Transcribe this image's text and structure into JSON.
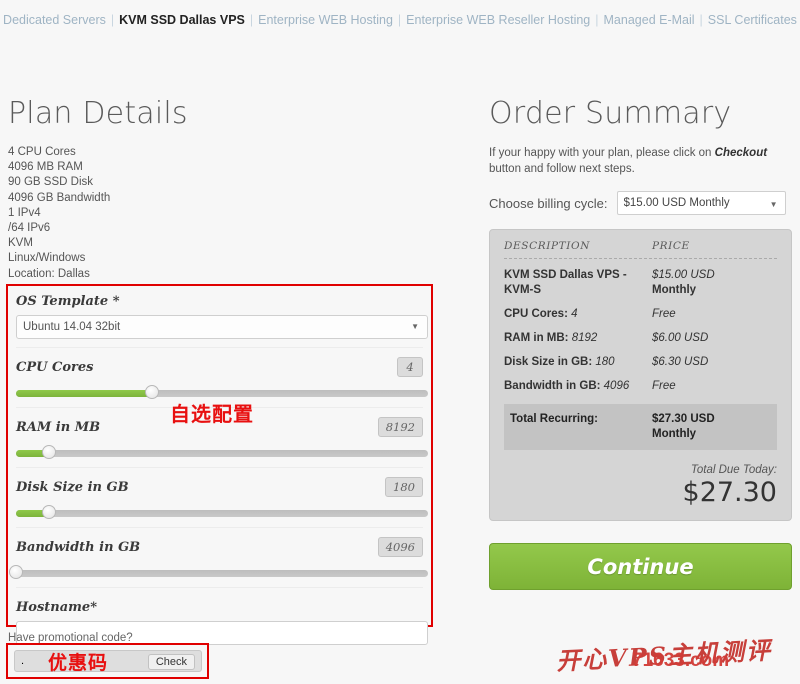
{
  "nav": {
    "items": [
      {
        "label": "Dedicated Servers",
        "active": false
      },
      {
        "label": "KVM SSD Dallas VPS",
        "active": true
      },
      {
        "label": "Enterprise WEB Hosting",
        "active": false
      },
      {
        "label": "Enterprise WEB Reseller Hosting",
        "active": false
      },
      {
        "label": "Managed E-Mail",
        "active": false
      },
      {
        "label": "SSL Certificates",
        "active": false
      }
    ],
    "separator": "|"
  },
  "plan": {
    "title": "Plan Details",
    "specs": [
      "4 CPU Cores",
      "4096 MB RAM",
      "90 GB SSD Disk",
      "4096 GB Bandwidth",
      "1 IPv4",
      "/64 IPv6",
      "KVM",
      "Linux/Windows",
      "Location: Dallas"
    ]
  },
  "config": {
    "annotation_cn": "自选配置",
    "os_template": {
      "label": "OS Template",
      "required_mark": " *",
      "value": "Ubuntu 14.04 32bit",
      "arrow": "▼"
    },
    "sliders": [
      {
        "label": "CPU Cores",
        "value": "4",
        "percent": 33
      },
      {
        "label": "RAM in MB",
        "value": "8192",
        "percent": 8
      },
      {
        "label": "Disk Size in GB",
        "value": "180",
        "percent": 8
      },
      {
        "label": "Bandwidth in GB",
        "value": "4096",
        "percent": 0
      }
    ],
    "hostname": {
      "label": "Hostname",
      "required_mark": "*",
      "value": "",
      "placeholder": ""
    }
  },
  "promo": {
    "label": "Have promotional code?",
    "input_value": ".",
    "placeholder": "",
    "check_label": "Check",
    "annotation_cn": "优惠码"
  },
  "order": {
    "title": "Order Summary",
    "intro_pre": "If your happy with your plan, please click on ",
    "intro_strong": "Checkout",
    "intro_post": " button and follow next steps.",
    "billing_label": "Choose billing cycle:",
    "billing_value": "$15.00 USD Monthly",
    "billing_arrow": "▼",
    "table": {
      "header": {
        "description": "DESCRIPTION",
        "price": "PRICE"
      },
      "rows": [
        {
          "description": "KVM SSD Dallas VPS - KVM-S",
          "desc_value": "",
          "price": "$15.00 USD",
          "price_sub": "Monthly"
        },
        {
          "description": "CPU Cores: ",
          "desc_value": "4",
          "price": "Free",
          "price_sub": ""
        },
        {
          "description": "RAM in MB: ",
          "desc_value": "8192",
          "price": "$6.00 USD",
          "price_sub": ""
        },
        {
          "description": "Disk Size in GB: ",
          "desc_value": "180",
          "price": "$6.30 USD",
          "price_sub": ""
        },
        {
          "description": "Bandwidth in GB: ",
          "desc_value": "4096",
          "price": "Free",
          "price_sub": ""
        }
      ],
      "total": {
        "label": "Total Recurring:",
        "price": "$27.30 USD",
        "price_sub": "Monthly"
      }
    },
    "due_label": "Total Due Today:",
    "due_amount": "$27.30",
    "continue_label": "Continue"
  },
  "watermark": {
    "text_cn": "开心VPS主机测评",
    "url": "71633.com"
  },
  "colors": {
    "accent_green": "#7eb337",
    "annotation_red": "#e00000",
    "nav_link": "#9fb4c4",
    "summary_bg": "#d5d5d5"
  }
}
